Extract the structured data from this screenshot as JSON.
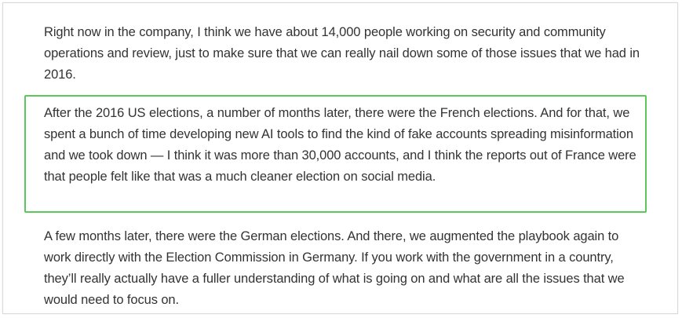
{
  "article": {
    "paragraphs": [
      "Right now in the company, I think we have about 14,000 people working on security and community operations and review, just to make sure that we can really nail down some of those issues that we had in 2016.",
      "After the 2016 US elections, a number of months later, there were the French elections. And for that, we spent a bunch of time developing new AI tools to find the kind of fake accounts spreading misinformation and we took down — I think it was more than 30,000 accounts, and I think the reports out of France were that people felt like that was a much cleaner election on social media.",
      "A few months later, there were the German elections. And there, we augmented the playbook again to work directly with the Election Commission in Germany. If you work with the government in a country, they’ll really actually have a fuller understanding of what is going on and what are all the issues that we would need to focus on."
    ],
    "highlight_color": "#5cc85c",
    "text_color": "#333333"
  }
}
